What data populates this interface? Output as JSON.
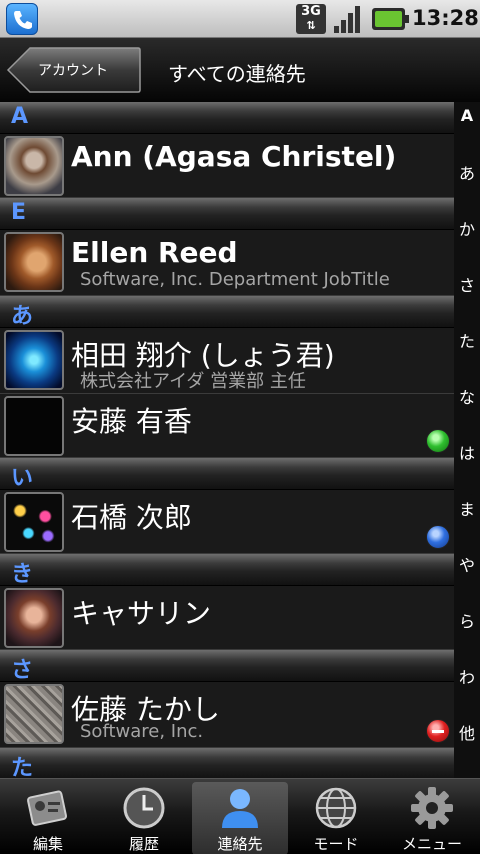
{
  "status_bar": {
    "network_label": "3G",
    "time": "13:28"
  },
  "header": {
    "back_label": "アカウント",
    "title": "すべての連絡先"
  },
  "sections": [
    {
      "letter": "A",
      "contacts": [
        {
          "name": "Ann (Agasa Christel)",
          "subtitle": "",
          "status": "",
          "avatar": "woman-with-hat"
        }
      ]
    },
    {
      "letter": "E",
      "contacts": [
        {
          "name": "Ellen Reed",
          "subtitle": "Software, Inc. Department JobTitle",
          "status": "",
          "avatar": "woman-sunglasses"
        }
      ]
    },
    {
      "letter": "あ",
      "contacts": [
        {
          "name": "相田 翔介 (しょう君)",
          "subtitle": "株式会社アイダ 営業部 主任",
          "status": "",
          "avatar": "blue-dots"
        },
        {
          "name": "安藤 有香",
          "subtitle": "",
          "status": "available",
          "avatar": "blank"
        }
      ]
    },
    {
      "letter": "い",
      "contacts": [
        {
          "name": "石橋 次郎",
          "subtitle": "",
          "status": "online",
          "avatar": "bokeh"
        }
      ]
    },
    {
      "letter": "き",
      "contacts": [
        {
          "name": "キャサリン",
          "subtitle": "",
          "status": "",
          "avatar": "woman-portrait"
        }
      ]
    },
    {
      "letter": "さ",
      "contacts": [
        {
          "name": "佐藤 たかし",
          "subtitle": "Software, Inc.",
          "status": "busy",
          "avatar": "leather-texture"
        }
      ]
    },
    {
      "letter": "た",
      "contacts": []
    }
  ],
  "index_letters": [
    "A",
    "あ",
    "か",
    "さ",
    "た",
    "な",
    "は",
    "ま",
    "や",
    "ら",
    "わ",
    "他"
  ],
  "tabs": [
    {
      "label": "編集",
      "icon": "edit-card-icon",
      "active": false
    },
    {
      "label": "履歴",
      "icon": "clock-icon",
      "active": false
    },
    {
      "label": "連絡先",
      "icon": "person-icon",
      "active": true
    },
    {
      "label": "モード",
      "icon": "globe-icon",
      "active": false
    },
    {
      "label": "メニュー",
      "icon": "gear-icon",
      "active": false
    }
  ],
  "colors": {
    "section_letter": "#5c97ff",
    "status_available": "#2fbf2f",
    "status_online": "#2f6fe0",
    "status_busy": "#e02020"
  }
}
